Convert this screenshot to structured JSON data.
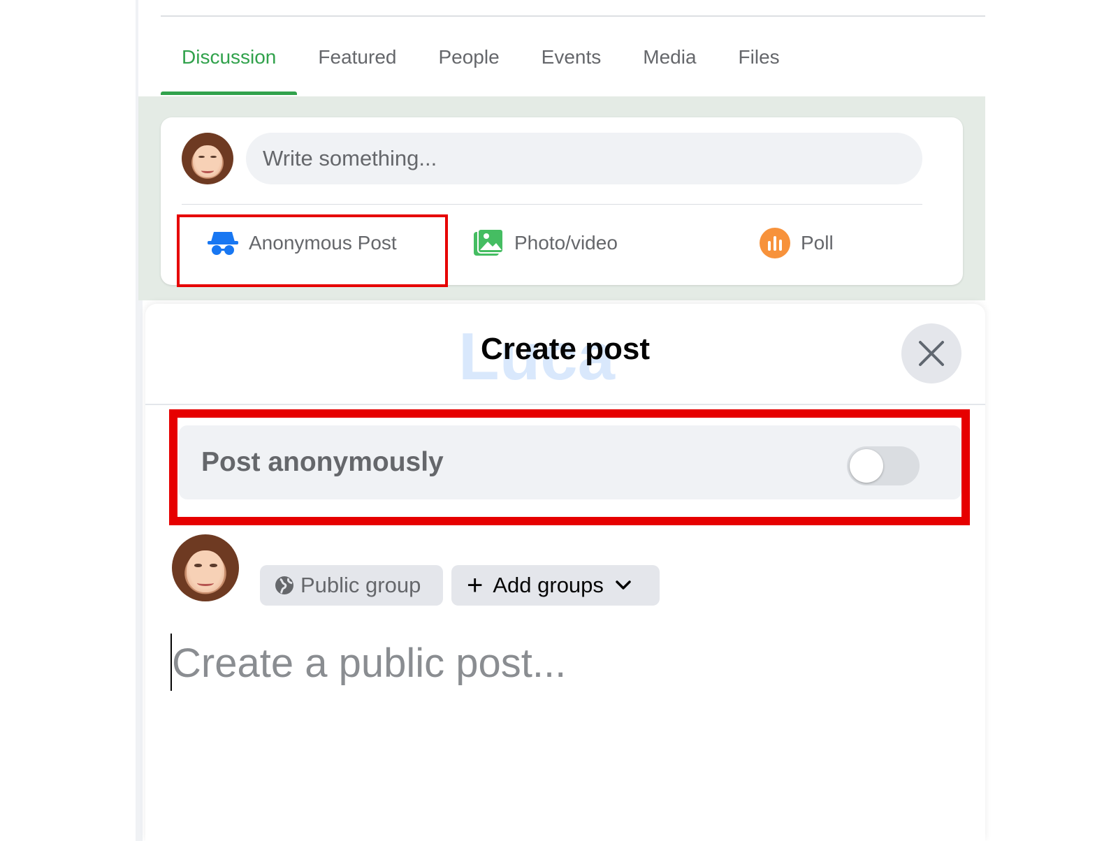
{
  "tabs": [
    {
      "label": "Discussion",
      "active": true
    },
    {
      "label": "Featured",
      "active": false
    },
    {
      "label": "People",
      "active": false
    },
    {
      "label": "Events",
      "active": false
    },
    {
      "label": "Media",
      "active": false
    },
    {
      "label": "Files",
      "active": false
    }
  ],
  "composer": {
    "placeholder": "Write something...",
    "actions": {
      "anonymous": {
        "label": "Anonymous Post",
        "icon": "incognito-icon"
      },
      "photo": {
        "label": "Photo/video",
        "icon": "photo-icon"
      },
      "poll": {
        "label": "Poll",
        "icon": "poll-icon"
      }
    }
  },
  "modal": {
    "title": "Create post",
    "anonymous_toggle": {
      "label": "Post anonymously",
      "on": false
    },
    "audience_label": "Public group",
    "add_groups_label": "Add groups",
    "post_placeholder": "Create a public post..."
  },
  "colors": {
    "accent_green": "#31a24c",
    "highlight_red": "#e60000",
    "incognito_blue": "#1877f2",
    "poll_orange": "#f7923b",
    "photo_green": "#45bd62"
  }
}
